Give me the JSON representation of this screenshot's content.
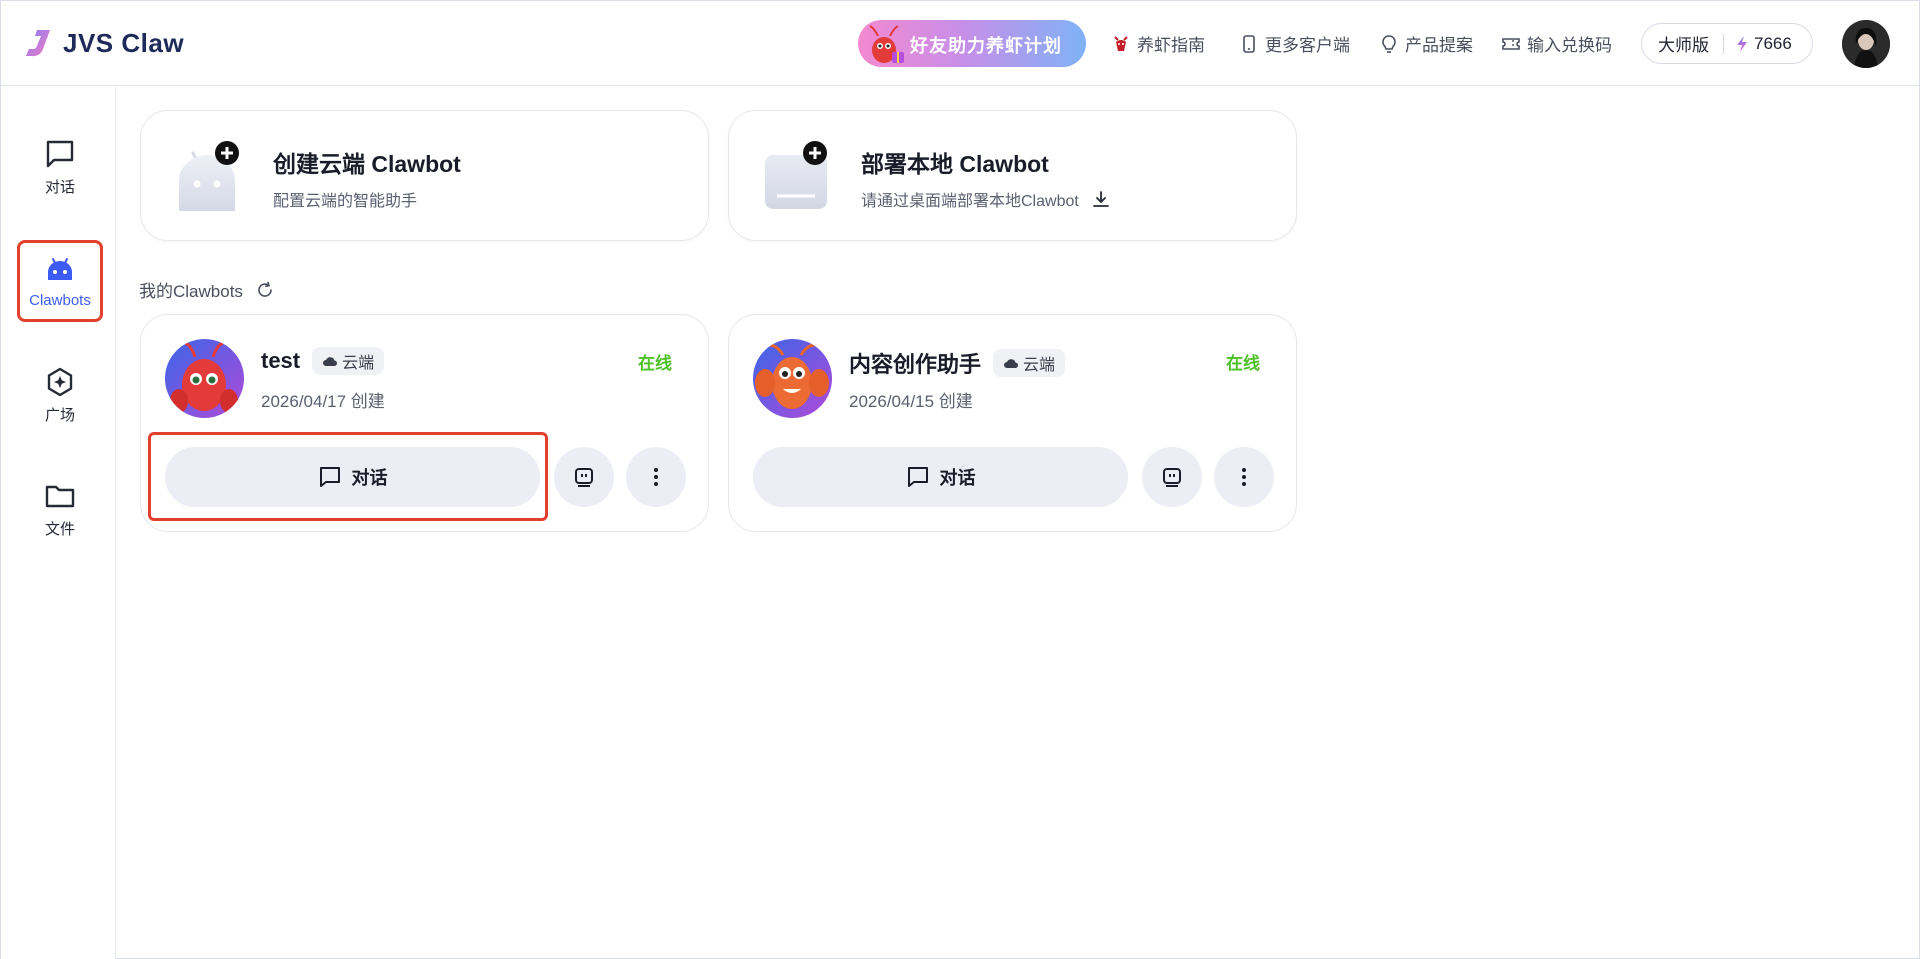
{
  "header": {
    "app_name": "JVS Claw",
    "promo_label": "好友助力养虾计划",
    "nav": [
      {
        "label": "养虾指南",
        "icon": "shrimp-icon"
      },
      {
        "label": "更多客户端",
        "icon": "phone-icon"
      },
      {
        "label": "产品提案",
        "icon": "lightbulb-icon"
      },
      {
        "label": "输入兑换码",
        "icon": "ticket-icon"
      }
    ],
    "plan_label": "大师版",
    "credits": "7666"
  },
  "sidebar": {
    "items": [
      {
        "label": "对话",
        "icon": "chat-icon"
      },
      {
        "label": "Clawbots",
        "icon": "bot-icon",
        "active": true
      },
      {
        "label": "广场",
        "icon": "plaza-icon"
      },
      {
        "label": "文件",
        "icon": "folder-icon"
      }
    ]
  },
  "create_cards": [
    {
      "title": "创建云端 Clawbot",
      "subtitle": "配置云端的智能助手"
    },
    {
      "title": "部署本地 Clawbot",
      "subtitle": "请通过桌面端部署本地Clawbot"
    }
  ],
  "section": {
    "title": "我的Clawbots"
  },
  "bots": [
    {
      "name": "test",
      "badge": "云端",
      "date": "2026/04/17 创建",
      "status": "在线",
      "chat_label": "对话"
    },
    {
      "name": "内容创作助手",
      "badge": "云端",
      "date": "2026/04/15 创建",
      "status": "在线",
      "chat_label": "对话"
    }
  ],
  "colors": {
    "accent": "#3d5cf5",
    "online": "#4fc128",
    "highlight": "#e0402c"
  }
}
